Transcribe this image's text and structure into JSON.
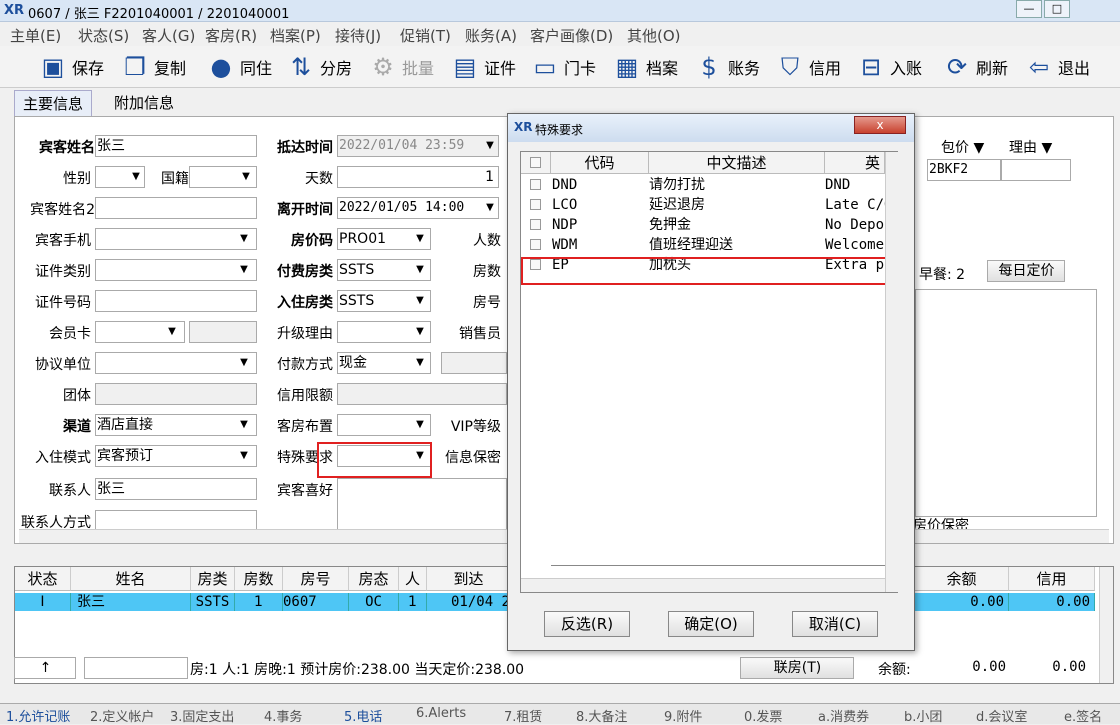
{
  "window": {
    "logo": "XR",
    "title": "0607 / 张三 F2201040001 / 2201040001",
    "min": "—",
    "max": "□"
  },
  "menu": [
    "主单(E)",
    "状态(S)",
    "客人(G)",
    "客房(R)",
    "档案(P)",
    "接待(J)",
    "促销(T)",
    "账务(A)",
    "客户画像(D)",
    "其他(O)"
  ],
  "toolbar": [
    "保存",
    "复制",
    "同住",
    "分房",
    "批量",
    "证件",
    "门卡",
    "档案",
    "账务",
    "信用",
    "入账",
    "刷新",
    "退出"
  ],
  "tabs": [
    "主要信息",
    "附加信息"
  ],
  "form": {
    "guest_name_label": "宾客姓名",
    "guest_name": "张三",
    "gender_label": "性别",
    "nationality_label": "国籍",
    "guest_name2_label": "宾客姓名2",
    "mobile_label": "宾客手机",
    "idtype_label": "证件类别",
    "idno_label": "证件号码",
    "member_label": "会员卡",
    "agreement_label": "协议单位",
    "group_label": "团体",
    "channel_label": "渠道",
    "channel": "酒店直接",
    "checkin_mode_label": "入住模式",
    "checkin_mode": "宾客预订",
    "contact_label": "联系人",
    "contact": "张三",
    "contact_method_label": "联系人方式",
    "arrival_label": "抵达时间",
    "arrival": "2022/01/04 23:59",
    "days_label": "天数",
    "days": "1",
    "departure_label": "离开时间",
    "departure": "2022/01/05 14:00",
    "rate_code_label": "房价码",
    "rate_code": "PRO01",
    "pay_type_label": "付费房类",
    "pay_type": "SSTS",
    "room_type_label": "入住房类",
    "room_type": "SSTS",
    "upgrade_label": "升级理由",
    "payment_label": "付款方式",
    "payment": "现金",
    "credit_label": "信用限额",
    "layout_label": "客房布置",
    "special_label": "特殊要求",
    "preference_label": "宾客喜好",
    "persons_label": "人数",
    "rooms_label": "房数",
    "roomno_label": "房号",
    "sales_label": "销售员",
    "vip_label": "VIP等级",
    "secret_label": "信息保密",
    "pkg_label": "包价",
    "reason_label": "理由",
    "pkg_value": "2BKF2",
    "breakfast": "早餐: 2",
    "daily_price": "每日定价",
    "price_secret": "房价保密"
  },
  "grid": {
    "headers": [
      "状态",
      "姓名",
      "房类",
      "房数",
      "房号",
      "房态",
      "人",
      "到达",
      "余额",
      "信用"
    ],
    "row": [
      "I",
      "张三",
      "SSTS",
      "1",
      "0607",
      "OC",
      "1",
      "01/04 2",
      "0.00",
      "0.00"
    ]
  },
  "statusline": {
    "up": "↑",
    "summary": "房:1  人:1  房晚:1  预计房价:238.00  当天定价:238.00",
    "join": "联房(T)",
    "balance_label": "余额:",
    "balance": "0.00",
    "credit": "0.00"
  },
  "bottom_tabs": [
    "1.允许记账",
    "2.定义帐户",
    "3.固定支出",
    "4.事务",
    "5.电话",
    "6.Alerts",
    "7.租赁",
    "8.大备注",
    "9.附件",
    "0.发票",
    "a.消费券",
    "b.小团",
    "d.会议室",
    "e.签名"
  ],
  "dialog": {
    "logo": "XR",
    "title": "特殊要求",
    "close": "x",
    "headers": [
      "代码",
      "中文描述",
      "英"
    ],
    "rows": [
      {
        "code": "DND",
        "cn": "请勿打扰",
        "en": "DND"
      },
      {
        "code": "LCO",
        "cn": "延迟退房",
        "en": "Late C/O"
      },
      {
        "code": "NDP",
        "cn": "免押金",
        "en": "No Deposit"
      },
      {
        "code": "WDM",
        "cn": "值班经理迎送",
        "en": "Welcome"
      },
      {
        "code": "EP",
        "cn": "加枕头",
        "en": "Extra pillow"
      }
    ],
    "invert": "反选(R)",
    "ok": "确定(O)",
    "cancel": "取消(C)"
  },
  "colors": {
    "selection": "#4ec6f5",
    "highlight": "#e02020",
    "accent": "#1d4f9c"
  }
}
